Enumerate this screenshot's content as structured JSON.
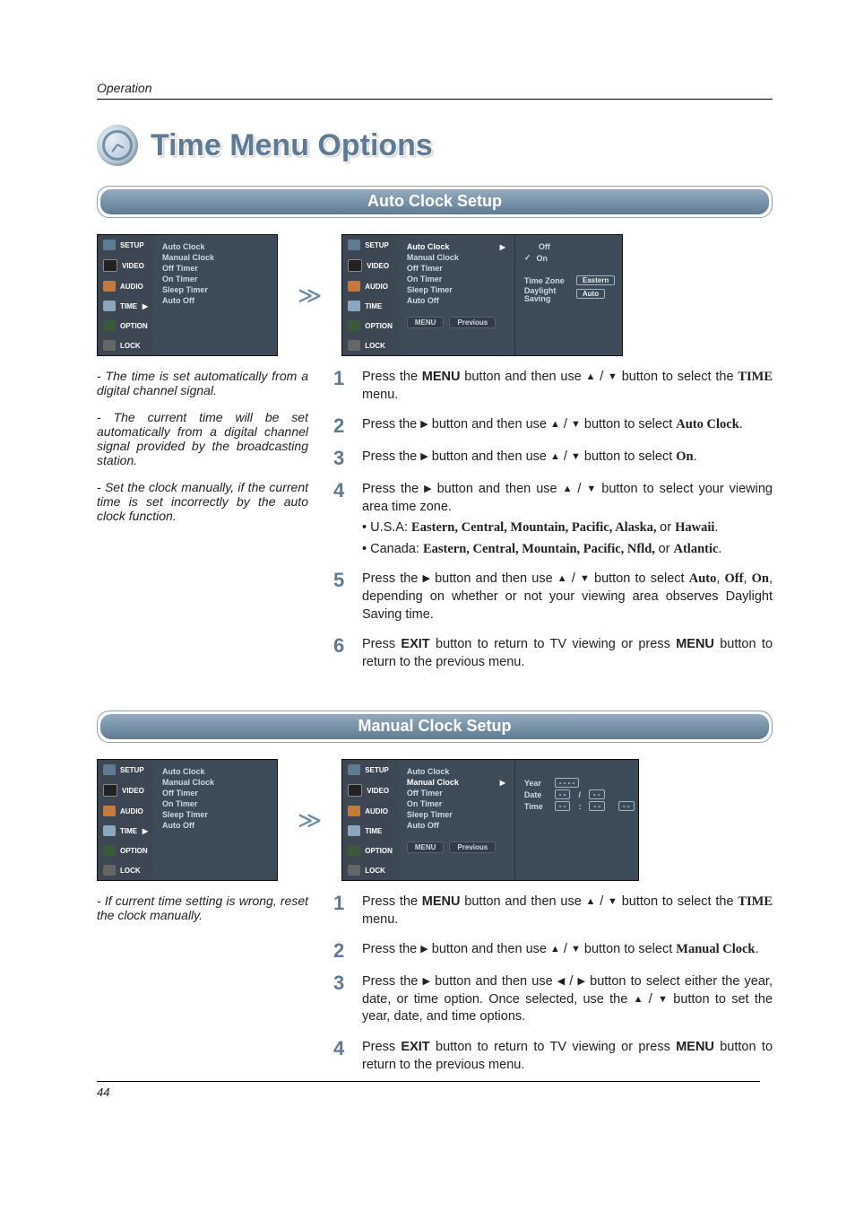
{
  "header": {
    "section": "Operation"
  },
  "title": "Time Menu Options",
  "page_number": "44",
  "osd": {
    "cats": [
      "SETUP",
      "VIDEO",
      "AUDIO",
      "TIME",
      "OPTION",
      "LOCK"
    ],
    "time_caret": "▶",
    "items": [
      "Auto Clock",
      "Manual Clock",
      "Off Timer",
      "On Timer",
      "Sleep Timer",
      "Auto Off"
    ],
    "foot_menu": "MENU",
    "foot_prev": "Previous"
  },
  "auto": {
    "bar": "Auto Clock Setup",
    "right": {
      "off": "Off",
      "on": "On",
      "tz_label": "Time Zone",
      "tz_value": "Eastern",
      "ds_label1": "Daylight",
      "ds_label2": "Saving",
      "ds_value": "Auto"
    },
    "notes": [
      "The time is set automatically from a digital channel signal.",
      "The current time will be set automatically from a digital channel signal provided by the broadcasting station.",
      "Set the clock manually, if the current time is set incorrectly by the auto clock function."
    ],
    "steps": {
      "s1_a": "Press the ",
      "s1_menu": "MENU",
      "s1_b": " button and then use ",
      "s1_c": " button to select the ",
      "s1_time": "TIME",
      "s1_d": " menu.",
      "s2_a": "Press the ",
      "s2_b": " button and then use ",
      "s2_c": " button to select ",
      "s2_sel": "Auto Clock",
      "s2_d": ".",
      "s3_a": "Press the ",
      "s3_b": " button and then use ",
      "s3_c": " button to select ",
      "s3_sel": "On",
      "s3_d": ".",
      "s4_a": "Press the ",
      "s4_b": " button and then use ",
      "s4_c": " button to select your viewing area time zone.",
      "s4_usa_l": "• U.S.A: ",
      "s4_usa_v": "Eastern, Central, Mountain, Pacific, Alaska, ",
      "s4_usa_or": "or ",
      "s4_usa_last": "Hawaii",
      "s4_usa_end": ".",
      "s4_can_l": "• Canada: ",
      "s4_can_v": "Eastern, Central, Mountain, Pacific, Nfld, ",
      "s4_can_or": "or ",
      "s4_can_last": "Atlantic",
      "s4_can_end": ".",
      "s5_a": "Press the ",
      "s5_b": " button and then use ",
      "s5_c": " button to select ",
      "s5_v1": "Auto",
      "s5_cm1": ", ",
      "s5_v2": "Off",
      "s5_cm2": ", ",
      "s5_v3": "On",
      "s5_d": ", depending on whether or not your viewing area observes Daylight Saving time.",
      "s6_a": "Press ",
      "s6_exit": "EXIT",
      "s6_b": " button to return to TV viewing or press ",
      "s6_menu": "MENU",
      "s6_c": " button to return to the previous menu."
    }
  },
  "manual": {
    "bar": "Manual Clock Setup",
    "right": {
      "year_l": "Year",
      "year_v": "- - - -",
      "date_l": "Date",
      "date_v1": "- -",
      "date_sep": "/",
      "date_v2": "- -",
      "time_l": "Time",
      "time_v1": "- -",
      "time_sep": ":",
      "time_v2": "- -",
      "time_v3": "- -"
    },
    "notes": [
      "If current time setting is wrong, reset the clock manually."
    ],
    "steps": {
      "s1_a": "Press the ",
      "s1_menu": "MENU",
      "s1_b": " button and then use ",
      "s1_c": " button to select the ",
      "s1_time": "TIME",
      "s1_d": " menu.",
      "s2_a": "Press the ",
      "s2_b": " button and then use ",
      "s2_c": " button to select ",
      "s2_sel": "Manual Clock",
      "s2_d": ".",
      "s3_a": "Press the ",
      "s3_b": " button and then use ",
      "s3_c": " button to select either the year, date, or time option. Once selected, use the ",
      "s3_d": " button to set the year, date, and time options.",
      "s4_a": "Press ",
      "s4_exit": "EXIT",
      "s4_b": " button to return to TV viewing or press ",
      "s4_menu": "MENU",
      "s4_c": " button to return to the previous menu."
    }
  }
}
